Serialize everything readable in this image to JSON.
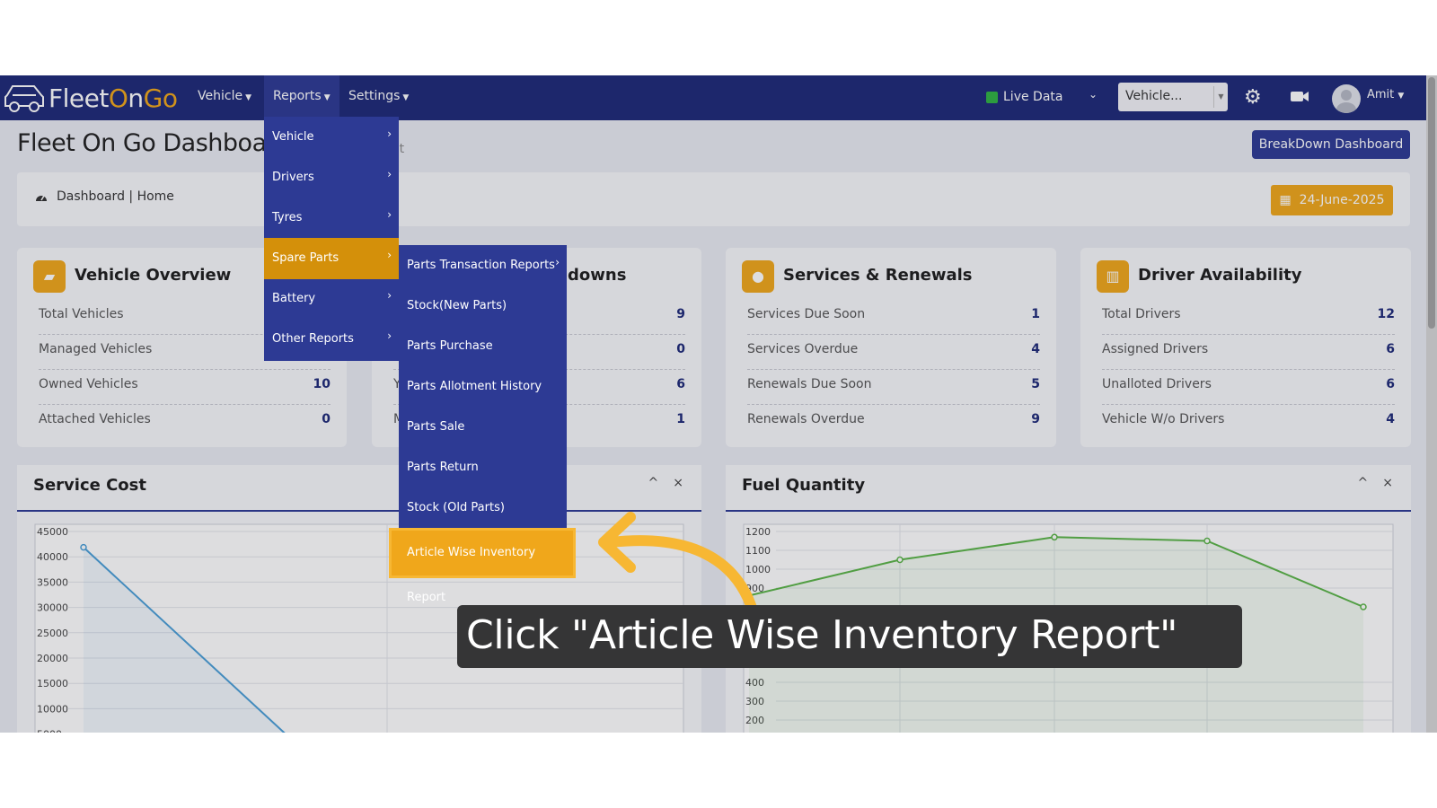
{
  "app": {
    "logo_text_pre": "Fleet",
    "logo_text_o": "O",
    "logo_text_mid": "n",
    "logo_text_go": "Go"
  },
  "navbar": {
    "items": [
      {
        "label": "Vehicle"
      },
      {
        "label": "Reports"
      },
      {
        "label": "Settings"
      }
    ],
    "live_data_label": "Live Data",
    "vehicle_select_value": "Vehicle...",
    "user_name": "Amit"
  },
  "page": {
    "title": "Fleet On Go Dashboa",
    "subtitle": "et",
    "breakdown_button": "BreakDown Dashboard",
    "breadcrumb": "Dashboard | Home",
    "date": "24-June-2025"
  },
  "cards": {
    "vehicle_overview": {
      "title": "Vehicle Overview",
      "rows": [
        {
          "label": "Total Vehicles",
          "value": ""
        },
        {
          "label": "Managed Vehicles",
          "value": ""
        },
        {
          "label": "Owned Vehicles",
          "value": "10"
        },
        {
          "label": "Attached Vehicles",
          "value": "0"
        }
      ]
    },
    "breakdowns": {
      "title": "downs",
      "rows": [
        {
          "label": "",
          "value": "9"
        },
        {
          "label": "",
          "value": "0"
        },
        {
          "label": "Y",
          "value": "6"
        },
        {
          "label": "M",
          "value": "1"
        }
      ]
    },
    "services": {
      "title": "Services & Renewals",
      "rows": [
        {
          "label": "Services Due Soon",
          "value": "1"
        },
        {
          "label": "Services Overdue",
          "value": "4"
        },
        {
          "label": "Renewals Due Soon",
          "value": "5"
        },
        {
          "label": "Renewals Overdue",
          "value": "9"
        }
      ]
    },
    "drivers": {
      "title": "Driver Availability",
      "rows": [
        {
          "label": "Total Drivers",
          "value": "12"
        },
        {
          "label": "Assigned Drivers",
          "value": "6"
        },
        {
          "label": "Unalloted Drivers",
          "value": "6"
        },
        {
          "label": "Vehicle W/o Drivers",
          "value": "4"
        }
      ]
    }
  },
  "charts": {
    "collapse_icon": "^",
    "close_icon": "×",
    "service_cost_title": "Service Cost",
    "fuel_quantity_title": "Fuel Quantity"
  },
  "chart_data": [
    {
      "type": "line",
      "title": "Service Cost",
      "ylim": [
        5000,
        45000
      ],
      "yticks": [
        "45000",
        "40000",
        "35000",
        "30000",
        "25000",
        "20000",
        "15000",
        "10000",
        "5000"
      ],
      "x": [
        0,
        1
      ],
      "values": [
        42500,
        5000
      ],
      "color": "#4a9fd8"
    },
    {
      "type": "line",
      "title": "Fuel Quantity",
      "ylim": [
        200,
        1200
      ],
      "yticks": [
        "1200",
        "1100",
        "1000",
        "900",
        "400",
        "300",
        "200"
      ],
      "x": [
        0,
        1,
        2,
        3,
        4
      ],
      "values": [
        860,
        1050,
        1170,
        1150,
        800
      ],
      "color": "#5bb548"
    }
  ],
  "reports_menu": {
    "items": [
      {
        "label": "Vehicle",
        "chevron": "›"
      },
      {
        "label": "Drivers",
        "chevron": "›"
      },
      {
        "label": "Tyres",
        "chevron": "›"
      },
      {
        "label": "Spare Parts",
        "chevron": "›"
      },
      {
        "label": "Battery",
        "chevron": "›"
      },
      {
        "label": "Other Reports",
        "chevron": "›"
      }
    ]
  },
  "spare_parts_menu": {
    "items": [
      {
        "label": "Parts Transaction Reports",
        "chevron": "›"
      },
      {
        "label": "Stock(New Parts)"
      },
      {
        "label": "Parts Purchase"
      },
      {
        "label": "Parts Allotment History"
      },
      {
        "label": "Parts Sale"
      },
      {
        "label": "Parts Return"
      },
      {
        "label": "Stock (Old Parts)"
      },
      {
        "label": "Article Wise Inventory Report"
      }
    ]
  },
  "callout": {
    "text": "Click \"Article Wise Inventory Report\""
  },
  "colors": {
    "navy": "#1e2a78",
    "menu": "#2d3a94",
    "accent": "#f0a71b"
  }
}
